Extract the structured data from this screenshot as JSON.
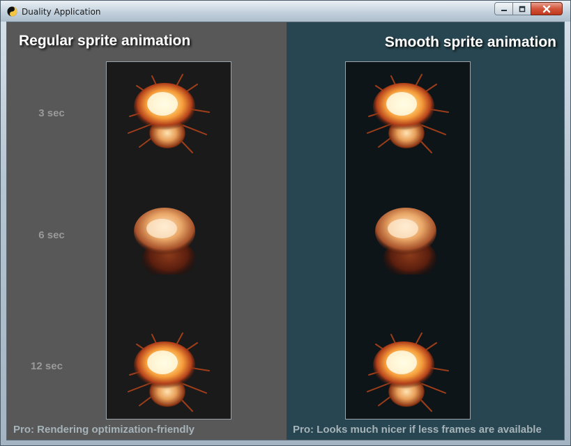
{
  "window": {
    "title": "Duality Application",
    "app_icon": "yin-yang-icon",
    "controls": [
      "minimize-icon",
      "maximize-icon",
      "close-icon"
    ]
  },
  "left_panel": {
    "heading": "Regular sprite animation",
    "background": "#585858",
    "time_labels": [
      "3 sec",
      "6 sec",
      "12 sec"
    ],
    "note": "Pro: Rendering optimization-friendly"
  },
  "right_panel": {
    "heading": "Smooth sprite animation",
    "background": "#284651",
    "note": "Pro: Looks much nicer if less frames are available"
  },
  "sprite_states": [
    "burst",
    "cloud",
    "burst"
  ],
  "colors": {
    "fire_core": "#fff3b0",
    "fire_mid": "#ffb347",
    "fire_outer": "#c4471a",
    "smoke": "#5a1e0e"
  }
}
